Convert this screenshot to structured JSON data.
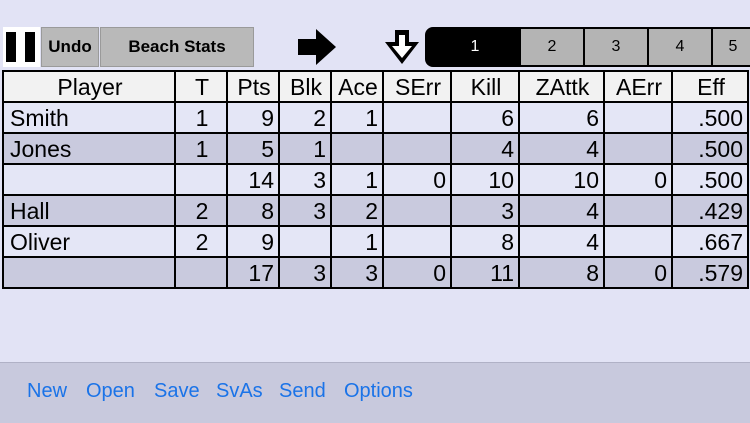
{
  "toolbar": {
    "undo_label": "Undo",
    "beach_label": "Beach Stats",
    "set_tabs": [
      "1",
      "2",
      "3",
      "4",
      "5"
    ],
    "active_set": "1"
  },
  "table": {
    "headers": [
      "Player",
      "T",
      "Pts",
      "Blk",
      "Ace",
      "SErr",
      "Kill",
      "ZAttk",
      "AErr",
      "Eff"
    ],
    "rows": [
      [
        "Smith",
        "1",
        "9",
        "2",
        "1",
        "",
        "6",
        "6",
        "",
        ".500"
      ],
      [
        "Jones",
        "1",
        "5",
        "1",
        "",
        "",
        "4",
        "4",
        "",
        ".500"
      ],
      [
        "",
        "",
        "14",
        "3",
        "1",
        "0",
        "10",
        "10",
        "0",
        ".500"
      ],
      [
        "Hall",
        "2",
        "8",
        "3",
        "2",
        "",
        "3",
        "4",
        "",
        ".429"
      ],
      [
        "Oliver",
        "2",
        "9",
        "",
        "1",
        "",
        "8",
        "4",
        "",
        ".667"
      ],
      [
        "",
        "",
        "17",
        "3",
        "3",
        "0",
        "11",
        "8",
        "0",
        ".579"
      ]
    ]
  },
  "bottom": {
    "new": "New",
    "open": "Open",
    "save": "Save",
    "save_as": "SvAs",
    "send": "Send",
    "options": "Options"
  },
  "colors": {
    "accent": "#1a73e8",
    "row_light": "#e4e6f6",
    "row_dark": "#c9cade",
    "bar_bg": "#c8c9dd"
  },
  "icons": [
    "pause-icon",
    "arrow-right-icon",
    "download-arrow-icon"
  ]
}
